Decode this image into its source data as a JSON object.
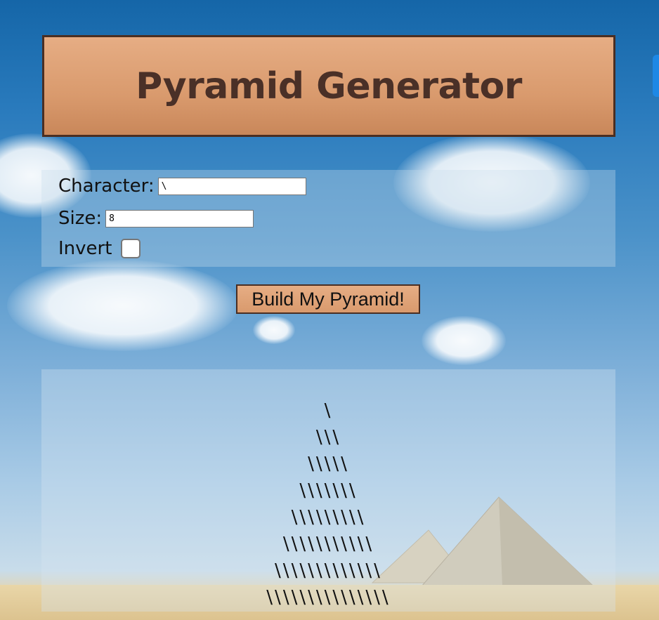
{
  "header": {
    "title": "Pyramid Generator"
  },
  "form": {
    "character_label": "Character:",
    "character_value": "\\",
    "size_label": "Size:",
    "size_value": "8",
    "invert_label": "Invert",
    "invert_checked": false
  },
  "build_button": {
    "label": "Build My Pyramid!"
  },
  "output": {
    "rows": [
      "\\",
      "\\\\\\",
      "\\\\\\\\\\",
      "\\\\\\\\\\\\\\",
      "\\\\\\\\\\\\\\\\\\",
      "\\\\\\\\\\\\\\\\\\\\\\",
      "\\\\\\\\\\\\\\\\\\\\\\\\\\",
      "\\\\\\\\\\\\\\\\\\\\\\\\\\\\\\"
    ]
  },
  "colors": {
    "header_bg": "#d99a6d",
    "header_border": "#4a2e22",
    "title_text": "#4a3027",
    "sky": "#2a7bbd",
    "accent_tab": "#1e88e5"
  }
}
